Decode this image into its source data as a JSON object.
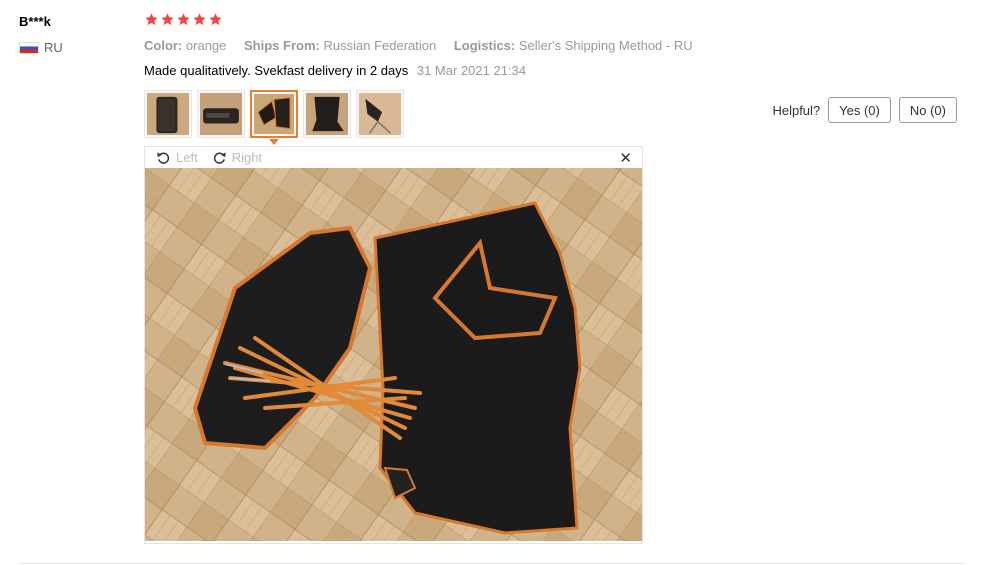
{
  "review": {
    "user": "B***k",
    "country": "RU",
    "rating": 5,
    "attributes": [
      {
        "label": "Color:",
        "value": "orange"
      },
      {
        "label": "Ships From:",
        "value": "Russian Federation"
      },
      {
        "label": "Logistics:",
        "value": "Seller's Shipping Method - RU"
      }
    ],
    "text": "Made qualitatively. Svekfast delivery in 2 days",
    "date": "31 Mar 2021 21:34"
  },
  "colors": {
    "star": "#f44343",
    "accent": "#f07a30"
  },
  "helpful": {
    "label": "Helpful?",
    "yes": "Yes (0)",
    "no": "No (0)"
  },
  "viewer": {
    "left_label": "Left",
    "right_label": "Right",
    "close": "✕"
  },
  "thumbnails": [
    "photo-1",
    "photo-2",
    "photo-3",
    "photo-4",
    "photo-5"
  ],
  "selected_thumbnail": 3
}
